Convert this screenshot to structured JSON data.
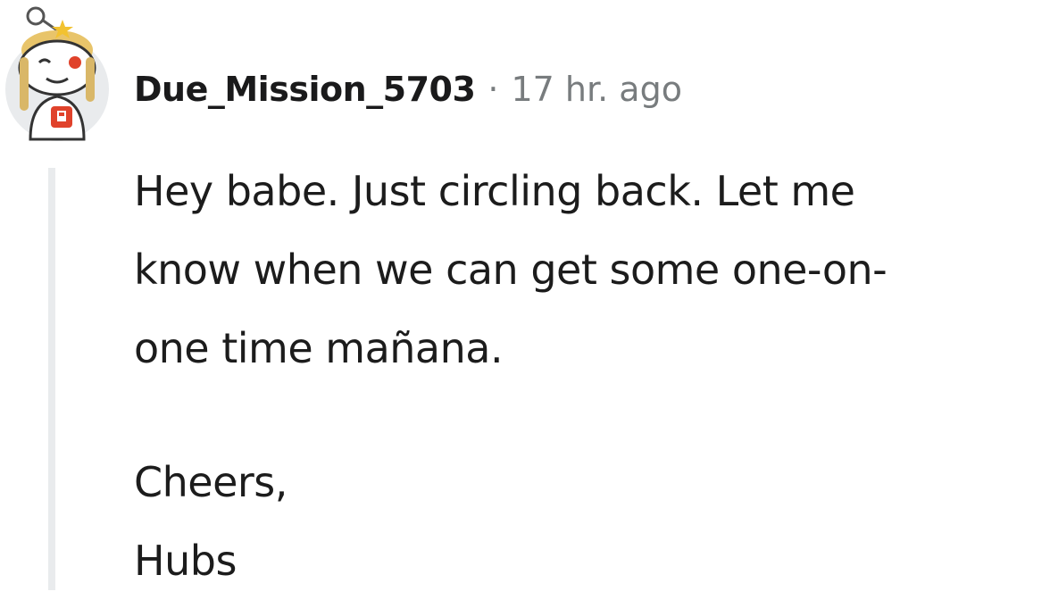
{
  "comment": {
    "username": "Due_Mission_5703",
    "separator": "·",
    "timestamp": "17 hr. ago",
    "body_lines": [
      "Hey babe. Just circling back. Let me",
      "know when we can get some one-on-",
      "one time mañana."
    ],
    "signoff_lines": [
      "Cheers,",
      "Hubs"
    ]
  },
  "avatar": {
    "icon": "snoo-avatar-icon",
    "badge_icon": "flag-badge-icon"
  }
}
